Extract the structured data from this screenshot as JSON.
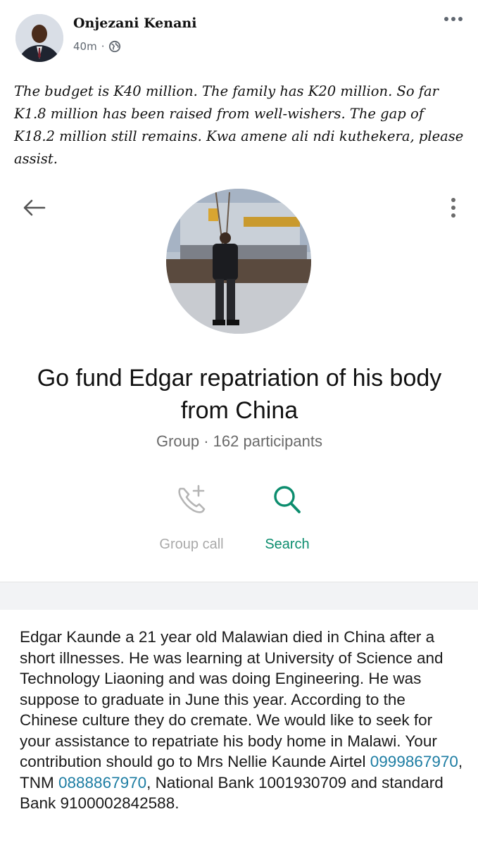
{
  "post": {
    "author": "Onjezani Kenani",
    "time": "40m",
    "separator": "·",
    "text": "The budget is K40 million. The family has K20 million. So far K1.8 million has been raised from well-wishers. The gap of K18.2 million still remains. Kwa amene ali ndi kuthekera, please assist."
  },
  "group": {
    "title": "Go fund Edgar repatriation of his body from China",
    "subtitle": "Group · 162 participants",
    "actions": {
      "call_label": "Group call",
      "search_label": "Search"
    },
    "description": {
      "part1": "Edgar Kaunde a 21 year old Malawian died in China after a short illnesses. He was learning at University of Science and Technology Liaoning and was doing Engineering. He was suppose to graduate in June this year. According to the Chinese culture they do cremate. We would like to seek for your assistance to repatriate his body home in Malawi. Your contribution should go to Mrs Nellie Kaunde Airtel ",
      "phone1": "0999867970",
      "part2": ", TNM ",
      "phone2": "0888867970",
      "part3": ", National Bank 1001930709 and standard Bank 9100002842588."
    }
  },
  "icons": {
    "more_post": "more-horizontal-icon",
    "globe": "globe-icon",
    "back": "back-arrow-icon",
    "menu": "more-vertical-icon",
    "call": "add-call-icon",
    "search": "search-icon"
  },
  "colors": {
    "accent_green": "#0c8d6e",
    "link_blue": "#1d7da3",
    "muted_gray": "#6a6a6a",
    "disabled_gray": "#a9a9a9"
  }
}
